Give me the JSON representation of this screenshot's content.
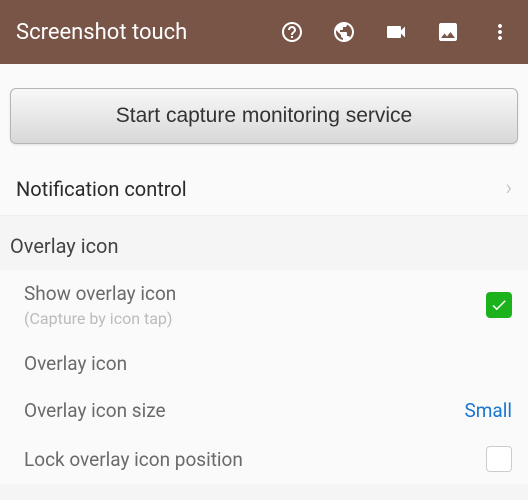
{
  "header": {
    "title": "Screenshot touch"
  },
  "main": {
    "start_button": "Start capture monitoring service",
    "notification_control": "Notification control"
  },
  "overlay": {
    "section_header": "Overlay icon",
    "show_overlay": {
      "label": "Show overlay icon",
      "sublabel": "(Capture by icon tap)",
      "checked": true
    },
    "overlay_icon": {
      "label": "Overlay icon"
    },
    "overlay_icon_size": {
      "label": "Overlay icon size",
      "value": "Small"
    },
    "lock_overlay": {
      "label": "Lock overlay icon position",
      "checked": false
    }
  }
}
